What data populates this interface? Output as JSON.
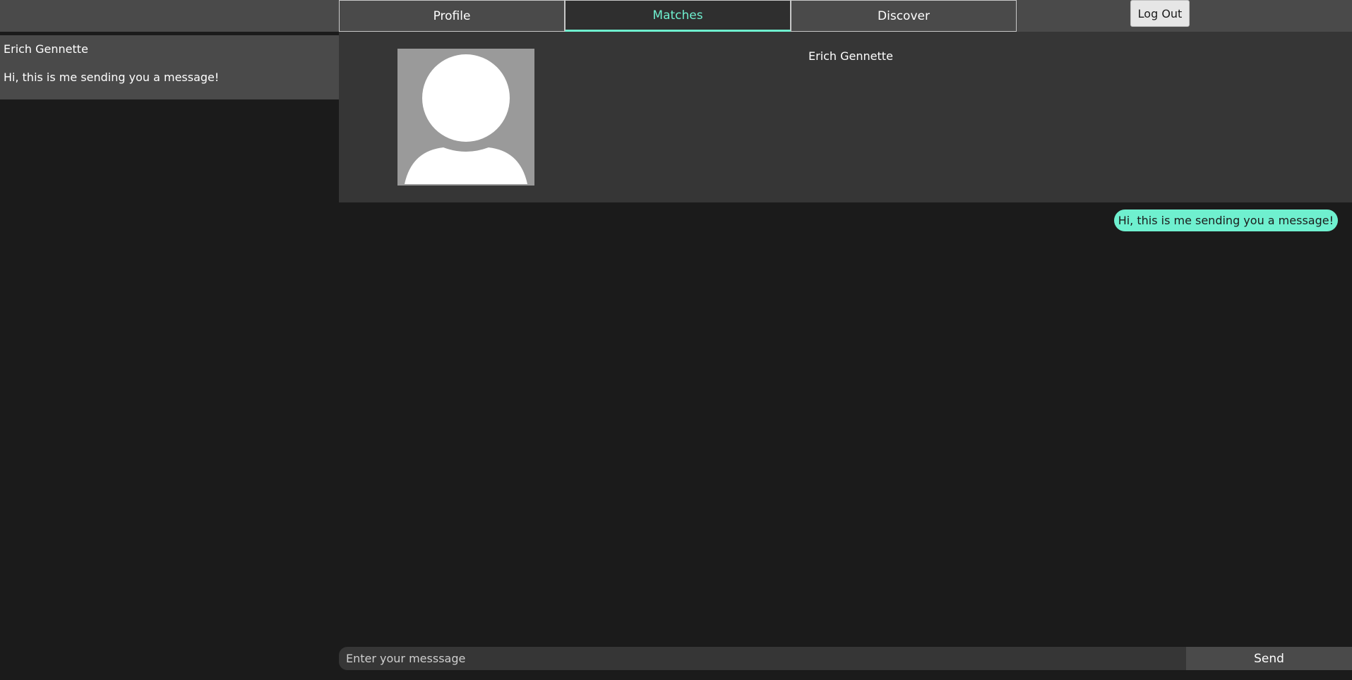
{
  "nav": {
    "tabs": [
      {
        "label": "Profile",
        "active": false
      },
      {
        "label": "Matches",
        "active": true
      },
      {
        "label": "Discover",
        "active": false
      }
    ],
    "logout_label": "Log Out"
  },
  "sidebar": {
    "conversations": [
      {
        "name": "Erich Gennette",
        "preview": "Hi, this is me sending you a message!"
      }
    ]
  },
  "match": {
    "name": "Erich Gennette",
    "avatar_icon": "default-user-icon"
  },
  "chat": {
    "messages": [
      {
        "text": "Hi, this is me sending you a message!",
        "from": "me"
      }
    ]
  },
  "composer": {
    "placeholder": "Enter your messsage",
    "send_label": "Send"
  },
  "colors": {
    "accent": "#6ff0cf",
    "background": "#1b1b1b",
    "panel": "#363636",
    "tab": "#4a4a4a"
  }
}
